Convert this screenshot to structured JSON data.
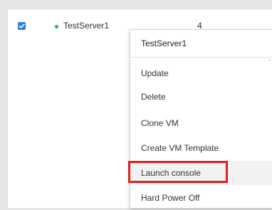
{
  "row": {
    "checked": true,
    "server_name": "TestServer1",
    "count": "4",
    "status_color": "#2bb24c"
  },
  "context_menu": {
    "title": "TestServer1",
    "items": [
      {
        "label": "Update"
      },
      {
        "label": "Delete"
      },
      {
        "label": "Clone VM"
      },
      {
        "label": "Create VM Template"
      },
      {
        "label": "Launch console",
        "highlighted": true
      },
      {
        "label": "Hard Power Off"
      }
    ]
  },
  "colors": {
    "checkbox": "#2b7de9",
    "highlight_box": "#e11d1d"
  }
}
